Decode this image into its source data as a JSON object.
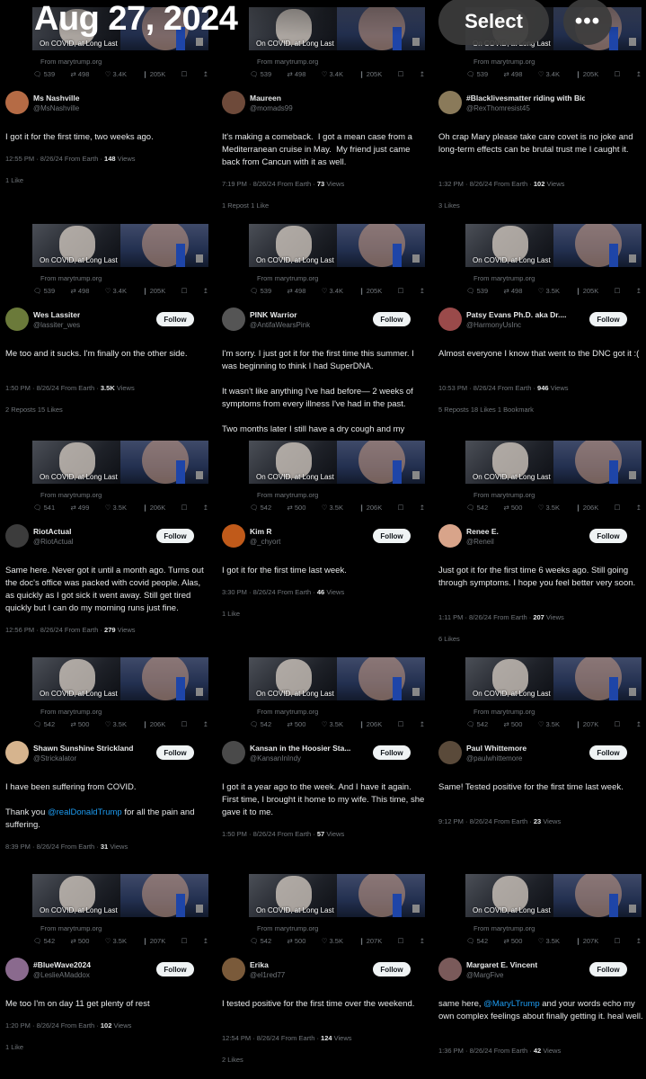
{
  "header": {
    "date": "Aug 27, 2024",
    "select_label": "Select",
    "more_glyph": "•••"
  },
  "media": {
    "caption": "On COVID, at Long Last",
    "source": "From marytrump.org"
  },
  "icons": {
    "reply": "reply-icon",
    "repost": "repost-icon",
    "like": "heart-icon",
    "bookmark": "bookmark-icon",
    "share": "share-icon"
  },
  "follow_label": "Follow",
  "views_suffix": "Views",
  "likes_label": "Likes",
  "like_label": "Like",
  "reposts_label": "Reposts",
  "repost_label": "Repost",
  "bookmark_label": "Bookmark",
  "from_earth": "From Earth",
  "columns": [
    [
      {
        "stats": [
          "539",
          "498",
          "3.4K",
          "205K"
        ],
        "name": "Ms Nashville",
        "handle": "@MsNashville",
        "follow": false,
        "text": "I got it for the first time, two weeks ago.",
        "time": "12:55 PM · 8/26/24",
        "views": "148",
        "engagement": "1 Like",
        "avatar_color": "#b56b45"
      },
      {
        "stats": [
          "539",
          "498",
          "3.4K",
          "205K"
        ],
        "name": "Wes Lassiter",
        "handle": "@lassiter_wes",
        "follow": true,
        "text": "Me too and it sucks. I'm finally on the other side.",
        "time": "1:50 PM · 8/26/24",
        "views": "3.5K",
        "engagement": "2 Reposts  15 Likes",
        "avatar_color": "#6b7a3a"
      },
      {
        "stats": [
          "541",
          "499",
          "3.5K",
          "206K"
        ],
        "name": "RiotActual",
        "handle": "@RiotActual",
        "follow": true,
        "text": "Same here. Never got it until a month ago. Turns out the doc's office was packed with covid people. Alas, as quickly as I got sick it went away. Still get tired quickly but I can do my morning runs just fine.",
        "time": "12:56 PM · 8/26/24",
        "views": "279",
        "engagement": "",
        "avatar_color": "#3c3c3c"
      },
      {
        "stats": [
          "542",
          "500",
          "3.5K",
          "206K"
        ],
        "name": "Shawn Sunshine Strickland",
        "handle": "@Strickalator",
        "follow": true,
        "text": "I have been suffering from COVID.\n\nThank you @realDonaldTrump for all the pain and suffering.",
        "mention": "@realDonaldTrump",
        "time": "8:39 PM · 8/26/24",
        "views": "31",
        "engagement": "",
        "avatar_color": "#d6b48e"
      },
      {
        "stats": [
          "542",
          "500",
          "3.5K",
          "207K"
        ],
        "name": "#BlueWave2024",
        "handle": "@LeslieAMaddox",
        "follow": true,
        "text": "Me too I'm on day 11 get plenty of rest",
        "time": "1:20 PM · 8/26/24",
        "views": "102",
        "engagement": "1 Like",
        "avatar_color": "#8a6a8e"
      }
    ],
    [
      {
        "stats": [
          "539",
          "498",
          "3.4K",
          "205K"
        ],
        "name": "Maureen",
        "handle": "@momads99",
        "follow": false,
        "text": "It's making a comeback.  I got a mean case from a Mediterranean cruise in May.  My friend just came back from Cancun with it as well.",
        "time": "7:19 PM · 8/26/24",
        "views": "73",
        "engagement": "1 Repost  1 Like",
        "avatar_color": "#6e4a3a"
      },
      {
        "stats": [
          "539",
          "498",
          "3.4K",
          "205K"
        ],
        "name": "PINK Warrior",
        "handle": "@AntifaWearsPink",
        "follow": true,
        "text": "I'm sorry. I just got it for the first time this summer. I was beginning to think I had SuperDNA. \n\nIt wasn't like anything I've had before— 2 weeks of symptoms from every illness I've had in the past.\n\nTwo months later I still have a dry cough and my",
        "time": "",
        "views": "",
        "engagement": "",
        "avatar_color": "#555555"
      },
      {
        "stats": [
          "542",
          "500",
          "3.5K",
          "206K"
        ],
        "name": "Kim R",
        "handle": "@_chyort",
        "follow": true,
        "text": "I got it for the first time last week.",
        "time": "3:30 PM · 8/26/24",
        "views": "46",
        "engagement": "1 Like",
        "avatar_color": "#c05a1a"
      },
      {
        "stats": [
          "542",
          "500",
          "3.5K",
          "206K"
        ],
        "name": "Kansan in the Hoosier Sta...",
        "handle": "@KansanInIndy",
        "follow": true,
        "text": "I got it a year ago to the week. And I have it again. First time, I brought it home to my wife. This time, she gave it to me.",
        "time": "1:50 PM · 8/26/24",
        "views": "57",
        "engagement": "",
        "avatar_color": "#4a4a4a"
      },
      {
        "stats": [
          "542",
          "500",
          "3.5K",
          "207K"
        ],
        "name": "Erika",
        "handle": "@el1red77",
        "follow": true,
        "text": "I tested positive for the first time over the weekend.",
        "time": "12:54 PM · 8/26/24",
        "views": "124",
        "engagement": "2 Likes",
        "avatar_color": "#7a5a3a"
      }
    ],
    [
      {
        "stats": [
          "539",
          "498",
          "3.4K",
          "205K"
        ],
        "name": "#Blacklivesmatter riding with Biden...",
        "handle": "@RexThomresist45",
        "follow": false,
        "text": "Oh crap Mary please take care covet is no joke and long-term effects can be brutal trust me I caught it.",
        "time": "1:32 PM · 8/26/24",
        "views": "102",
        "engagement": "3 Likes",
        "avatar_color": "#8a7a5a"
      },
      {
        "stats": [
          "539",
          "498",
          "3.5K",
          "205K"
        ],
        "name": "Patsy Evans Ph.D. aka Dr....",
        "handle": "@HarmonyUsInc",
        "follow": true,
        "text": "Almost everyone I know that went to the DNC got it :(",
        "time": "10:53 PM · 8/26/24",
        "views": "946",
        "engagement": "5 Reposts  18 Likes  1 Bookmark",
        "avatar_color": "#9a4a4a"
      },
      {
        "stats": [
          "542",
          "500",
          "3.5K",
          "206K"
        ],
        "name": "Renee E.",
        "handle": "@Reneil",
        "follow": true,
        "text": "Just got it for the first time 6 weeks ago. Still going through symptoms. I hope you feel better very soon.",
        "time": "1:11 PM · 8/26/24",
        "views": "207",
        "engagement": "6 Likes",
        "avatar_color": "#d8a48a"
      },
      {
        "stats": [
          "542",
          "500",
          "3.5K",
          "207K"
        ],
        "name": "Paul Whittemore",
        "handle": "@paulwhittemore",
        "follow": true,
        "text": "Same! Tested positive for the first time last week.",
        "time": "9:12 PM · 8/26/24",
        "views": "23",
        "engagement": "",
        "avatar_color": "#5a4a3a"
      },
      {
        "stats": [
          "542",
          "500",
          "3.5K",
          "207K"
        ],
        "name": "Margaret E. Vincent",
        "handle": "@MargFive",
        "follow": true,
        "text": "same here, @MaryLTrump and your words echo my own complex feelings about finally getting it. heal well.",
        "mention": "@MaryLTrump",
        "time": "1:36 PM · 8/26/24",
        "views": "42",
        "engagement": "",
        "avatar_color": "#7a5a5a"
      }
    ]
  ]
}
